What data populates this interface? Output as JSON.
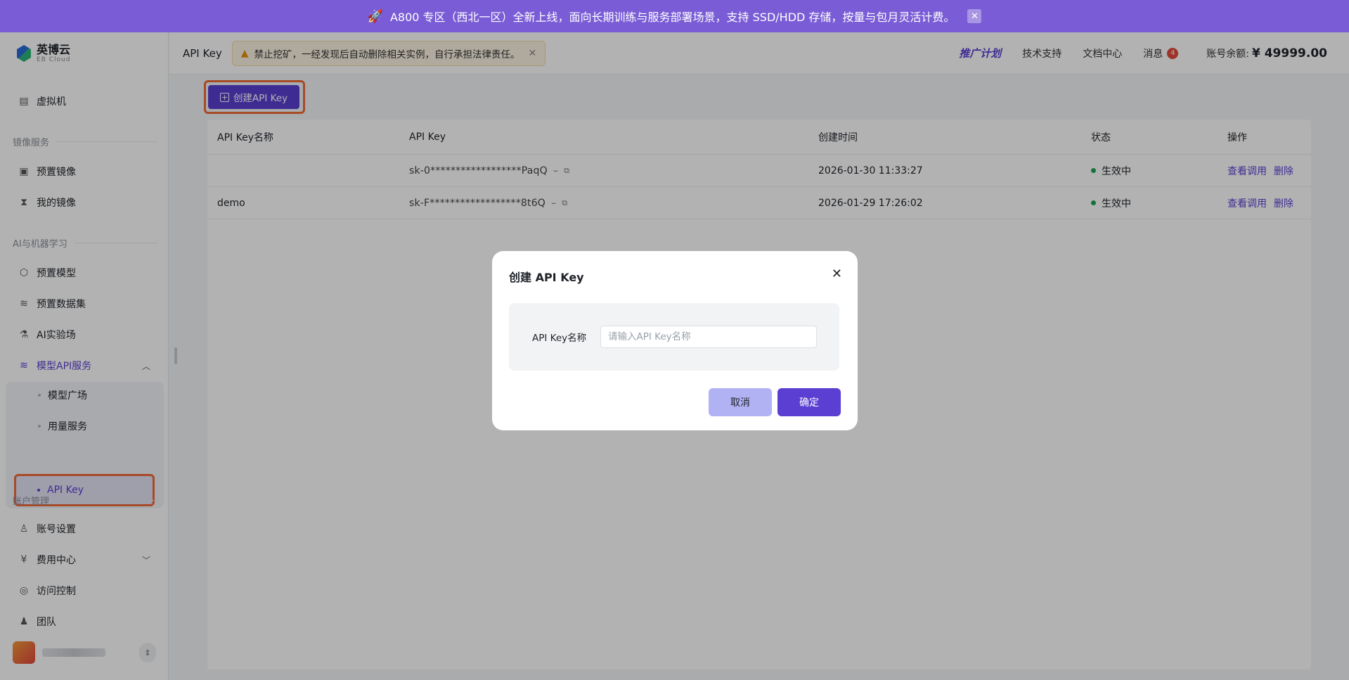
{
  "banner": {
    "text": "A800 专区（西北一区）全新上线，面向长期训练与服务部署场景，支持 SSD/HDD 存储，按量与包月灵活计费。",
    "icon": "rocket-icon",
    "close": "✕"
  },
  "logo": {
    "name": "英博云",
    "sub": "EB Cloud"
  },
  "sidebar": {
    "vm": "虚拟机",
    "section_image": "镜像服务",
    "preset_image": "预置镜像",
    "my_image": "我的镜像",
    "section_ai": "AI与机器学习",
    "preset_model": "预置模型",
    "preset_dataset": "预置数据集",
    "ai_lab": "AI实验场",
    "model_api": "模型API服务",
    "model_square": "模型广场",
    "usage_service": "用量服务",
    "api_key": "API Key",
    "section_account": "账户管理",
    "account_settings": "账号设置",
    "billing": "费用中心",
    "access_control": "访问控制",
    "team": "团队"
  },
  "header": {
    "title": "API Key",
    "warning": "禁止挖矿，一经发现后自动删除相关实例，自行承担法律责任。",
    "promo": "推广计划",
    "support": "技术支持",
    "docs": "文档中心",
    "messages": "消息",
    "message_count": "4",
    "balance_label": "账号余额:",
    "balance": "¥ 49999.00"
  },
  "main": {
    "create_button": "创建API Key",
    "columns": [
      "API Key名称",
      "API Key",
      "创建时间",
      "状态",
      "操作"
    ],
    "rows": [
      {
        "name": "",
        "key": "sk-0******************PaqQ",
        "created": "2026-01-30 11:33:27",
        "status": "生效中",
        "view": "查看调用",
        "delete": "删除"
      },
      {
        "name": "demo",
        "key": "sk-F******************8t6Q",
        "created": "2026-01-29 17:26:02",
        "status": "生效中",
        "view": "查看调用",
        "delete": "删除"
      }
    ]
  },
  "modal": {
    "title": "创建 API Key",
    "field_label": "API Key名称",
    "field_value": "",
    "field_placeholder": "请输入API Key名称",
    "cancel": "取消",
    "confirm": "确定"
  },
  "colors": {
    "brand": "#5b3fd3",
    "banner": "#7a5cd6",
    "highlight": "#ef6a3a",
    "status_active": "#20a35a"
  }
}
